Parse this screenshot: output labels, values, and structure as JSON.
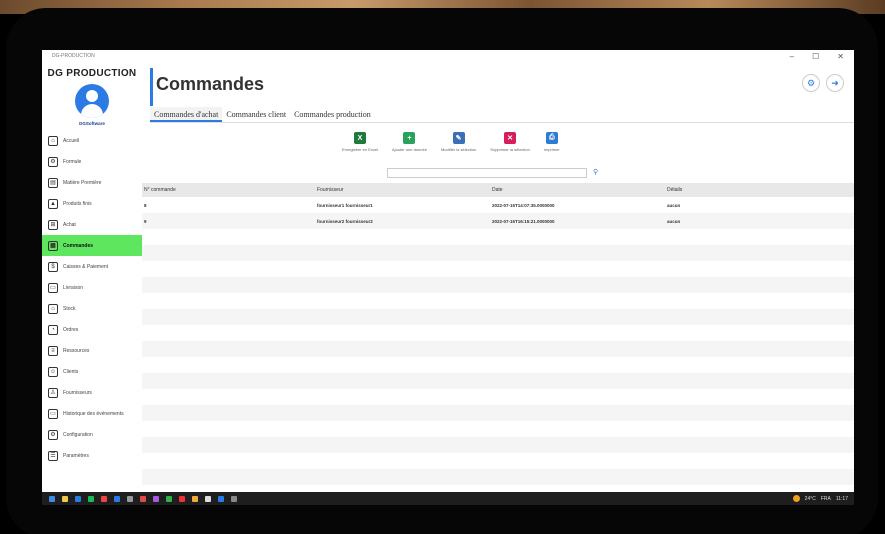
{
  "window": {
    "app_name": "DG-PRODUCTION",
    "controls": [
      "–",
      "☐",
      "✕"
    ]
  },
  "sidebar": {
    "brand": "DG PRODUCTION",
    "software": "DGSoftware",
    "items": [
      {
        "label": "Accueil",
        "icon": "home-icon",
        "glyph": "⌂"
      },
      {
        "label": "Formule",
        "icon": "formula-icon",
        "glyph": "⚙"
      },
      {
        "label": "Matière Première",
        "icon": "materials-icon",
        "glyph": "▤"
      },
      {
        "label": "Produits finis",
        "icon": "products-icon",
        "glyph": "▲"
      },
      {
        "label": "Achat",
        "icon": "cart-icon",
        "glyph": "⊞"
      },
      {
        "label": "Commandes",
        "icon": "orders-icon",
        "glyph": "▦"
      },
      {
        "label": "Caisses & Paiement",
        "icon": "payment-icon",
        "glyph": "$"
      },
      {
        "label": "Livraison",
        "icon": "delivery-icon",
        "glyph": "▭"
      },
      {
        "label": "Stock",
        "icon": "stock-icon",
        "glyph": "⌂"
      },
      {
        "label": "Ordres",
        "icon": "order-icon",
        "glyph": "◔"
      },
      {
        "label": "Ressources",
        "icon": "resources-icon",
        "glyph": "≡"
      },
      {
        "label": "Clients",
        "icon": "clients-icon",
        "glyph": "☺"
      },
      {
        "label": "Fournisseurs",
        "icon": "supplier-icon",
        "glyph": "♙"
      },
      {
        "label": "Historique des événements",
        "icon": "history-icon",
        "glyph": "▭"
      },
      {
        "label": "Configuration",
        "icon": "config-icon",
        "glyph": "⚙"
      },
      {
        "label": "Paramètres",
        "icon": "settings-icon",
        "glyph": "☰"
      }
    ]
  },
  "main": {
    "title": "Commandes",
    "tabs": [
      "Commandes d'achat",
      "Commandes client",
      "Commandes production"
    ],
    "toolbar": [
      {
        "label": "Enregistrer en Excel",
        "icon": "excel-icon",
        "color": "#1e7a3c",
        "glyph": "X"
      },
      {
        "label": "Ajouter une donnée",
        "icon": "add-icon",
        "color": "#2aa15a",
        "glyph": "+"
      },
      {
        "label": "Modifier la sélection",
        "icon": "edit-icon",
        "color": "#3b6fb6",
        "glyph": "✎"
      },
      {
        "label": "Supprimer la sélection",
        "icon": "delete-icon",
        "color": "#d61f5a",
        "glyph": "✕"
      },
      {
        "label": "Imprimer",
        "icon": "print-icon",
        "color": "#2f7bd1",
        "glyph": "⎙"
      }
    ],
    "search": {
      "value": "",
      "placeholder": ""
    },
    "table": {
      "columns": [
        "N° commande",
        "Fournisseur",
        "Date",
        "Détails"
      ],
      "rows": [
        [
          "8",
          "fournisseur1 fournisseur1",
          "2022-07-15T14:07:35.0000000",
          "aucun"
        ],
        [
          "9",
          "fournisseur2 fournisseur2",
          "2022-07-15T16:15:21.0000000",
          "aucun"
        ]
      ]
    }
  },
  "taskbar": {
    "weather": "24°C",
    "lang": "FRA",
    "time": "11:17"
  }
}
